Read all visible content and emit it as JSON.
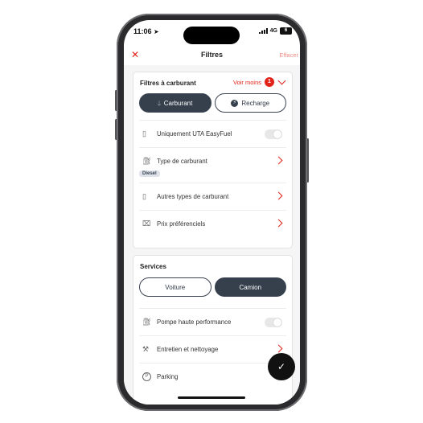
{
  "status_bar": {
    "time": "11:06",
    "network": "4G",
    "battery": "6"
  },
  "nav": {
    "close_icon": "close-icon",
    "title": "Filtres",
    "clear_label": "Effacer"
  },
  "fuel_filters": {
    "title": "Filtres à carburant",
    "see_less_label": "Voir moins",
    "active_count": "1",
    "segments": [
      {
        "label": "Carburant",
        "icon": "drop-icon",
        "active": true
      },
      {
        "label": "Recharge",
        "icon": "plug-icon",
        "active": false
      }
    ],
    "rows": [
      {
        "label": "Uniquement UTA EasyFuel",
        "icon": "phone-fuel-icon",
        "control": "toggle",
        "on": false
      },
      {
        "label": "Type de carburant",
        "icon": "fuel-pump-icon",
        "control": "chevron",
        "chip": "Diesel"
      },
      {
        "label": "Autres types de carburant",
        "icon": "fuel-can-icon",
        "control": "chevron"
      },
      {
        "label": "Prix préférenciels",
        "icon": "price-tag-icon",
        "control": "chevron"
      }
    ]
  },
  "services": {
    "title": "Services",
    "segments": [
      {
        "label": "Voiture",
        "active": false
      },
      {
        "label": "Camion",
        "active": true
      }
    ],
    "rows": [
      {
        "label": "Pompe haute performance",
        "icon": "pump-icon",
        "control": "toggle",
        "on": false
      },
      {
        "label": "Entretien et nettoyage",
        "icon": "wrench-icon",
        "control": "chevron"
      },
      {
        "label": "Parking",
        "icon": "parking-icon",
        "control": "chevron"
      }
    ]
  },
  "fab": {
    "icon": "checkmark-icon"
  },
  "colors": {
    "accent": "#e2231a",
    "dark": "#36404d"
  }
}
